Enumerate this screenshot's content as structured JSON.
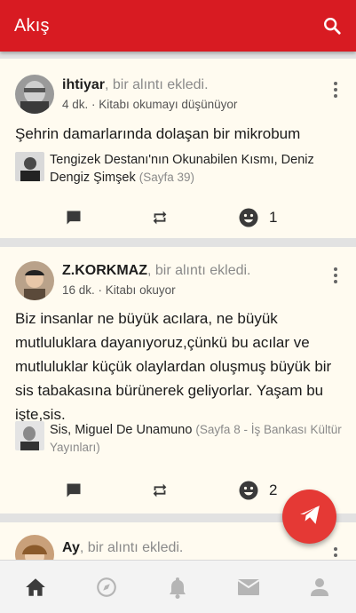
{
  "appbar": {
    "title": "Akış",
    "search_icon": "search-icon"
  },
  "posts": [
    {
      "username": "ihtiyar",
      "action": ", bir alıntı ekledi.",
      "time": "4 dk.",
      "status_prefix": "Kitabı",
      "status": "okumayı düşünüyor",
      "quote": "Şehrin damarlarında dolaşan bir mikrobum",
      "book_title": "Tengizek Destanı'nın Okunabilen Kısmı, Deniz Dengiz Şimşek",
      "book_page": "(Sayfa 39)",
      "likes": "1"
    },
    {
      "username": "Z.KORKMAZ",
      "action": ", bir alıntı ekledi.",
      "time": "16 dk.",
      "status_prefix": "Kitabı",
      "status": "okuyor",
      "quote": "Biz insanlar ne büyük acılara, ne büyük mutluluklara dayanıyoruz,çünkü bu acılar ve mutluluklar küçük olaylardan oluşmuş büyük bir sis tabakasına bürünerek geliyorlar. Yaşam bu işte,sis.",
      "book_title": "Sis, Miguel De Unamuno",
      "book_page": "(Sayfa 8 - İş Bankası Kültür Yayınları)",
      "likes": "2"
    },
    {
      "username": "Ay",
      "action": ", bir alıntı ekledi."
    }
  ],
  "bottom_nav": [
    "home-icon",
    "compass-icon",
    "bell-icon",
    "mail-icon",
    "profile-icon"
  ],
  "colors": {
    "brand": "#d81b22",
    "fab": "#e53935",
    "card": "#fffbf0"
  }
}
